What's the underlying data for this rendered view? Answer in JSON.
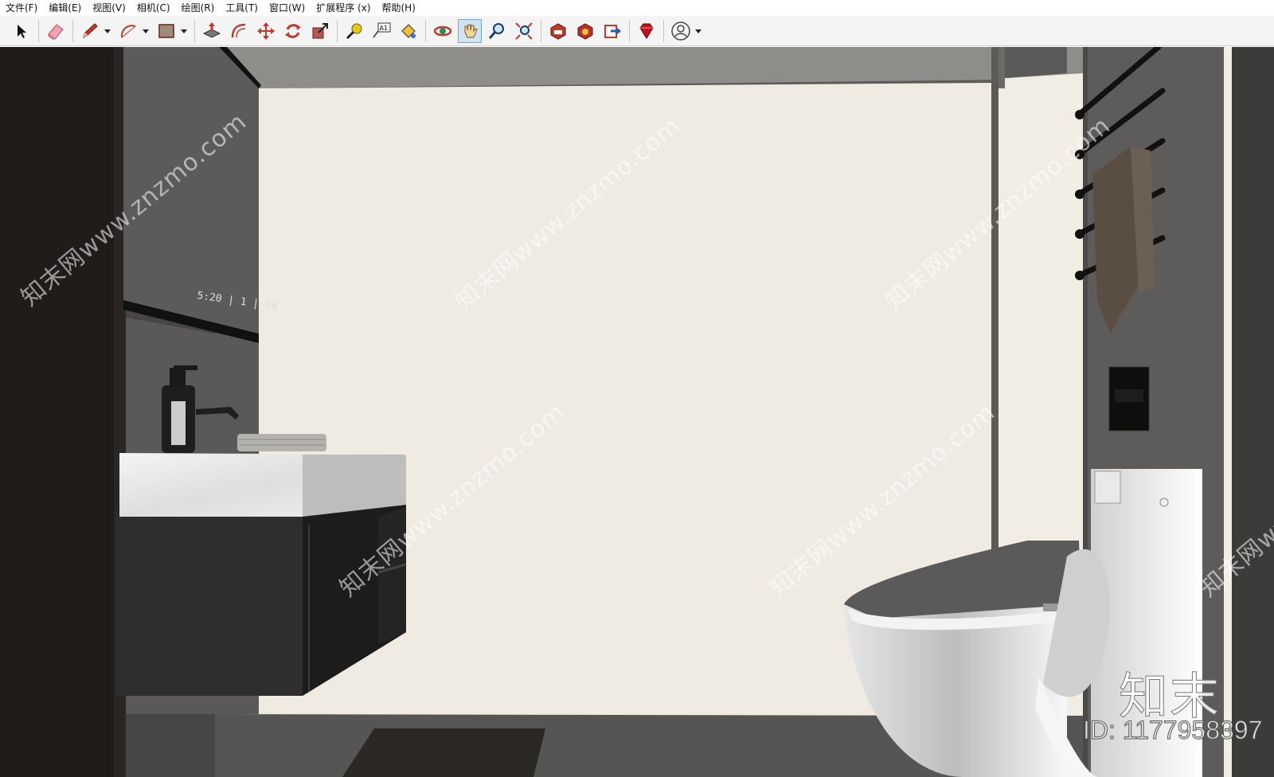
{
  "menubar": {
    "items": [
      {
        "label": "文件(F)"
      },
      {
        "label": "编辑(E)"
      },
      {
        "label": "视图(V)"
      },
      {
        "label": "相机(C)"
      },
      {
        "label": "绘图(R)"
      },
      {
        "label": "工具(T)"
      },
      {
        "label": "窗口(W)"
      },
      {
        "label": "扩展程序 (x)"
      },
      {
        "label": "帮助(H)"
      }
    ]
  },
  "toolbar": {
    "tools": [
      {
        "name": "select-tool",
        "icon": "arrow-cursor-icon"
      },
      {
        "name": "eraser-tool",
        "icon": "eraser-icon"
      },
      {
        "name": "line-tool",
        "icon": "pencil-icon"
      },
      {
        "name": "arc-tool",
        "icon": "arc-icon"
      },
      {
        "name": "shape-tool",
        "icon": "rectangle-icon"
      },
      {
        "name": "push-pull-tool",
        "icon": "push-pull-icon"
      },
      {
        "name": "offset-tool",
        "icon": "offset-icon"
      },
      {
        "name": "move-tool",
        "icon": "move-icon"
      },
      {
        "name": "rotate-tool",
        "icon": "rotate-icon"
      },
      {
        "name": "scale-tool",
        "icon": "scale-icon"
      },
      {
        "name": "tape-measure-tool",
        "icon": "tape-measure-icon"
      },
      {
        "name": "text-tool",
        "icon": "text-label-icon"
      },
      {
        "name": "paint-bucket-tool",
        "icon": "paint-bucket-icon"
      },
      {
        "name": "orbit-tool",
        "icon": "orbit-icon"
      },
      {
        "name": "pan-tool",
        "icon": "hand-icon",
        "active": true
      },
      {
        "name": "zoom-tool",
        "icon": "magnifier-icon"
      },
      {
        "name": "zoom-extents-tool",
        "icon": "zoom-extents-icon"
      },
      {
        "name": "3d-warehouse",
        "icon": "warehouse-icon"
      },
      {
        "name": "extension-warehouse",
        "icon": "extension-warehouse-icon"
      },
      {
        "name": "layout-send",
        "icon": "send-to-layout-icon"
      },
      {
        "name": "ruby-console",
        "icon": "ruby-gem-icon"
      },
      {
        "name": "account",
        "icon": "user-avatar-icon"
      }
    ],
    "text_tool_glyph": "A1"
  },
  "scene": {
    "mirror_clock": "5:20 | 1 | 14",
    "watermark_text": "知末网www.znzmo.com",
    "brand_logo": "知末",
    "brand_id": "ID: 1177958397",
    "colors": {
      "back_wall": "#efebe2",
      "ceiling": "#8e8d89",
      "left_panel": "#201c19",
      "floor": "#565654",
      "vanity_cabinet": "#2e2e2e",
      "countertop": "#eeeeee"
    }
  }
}
